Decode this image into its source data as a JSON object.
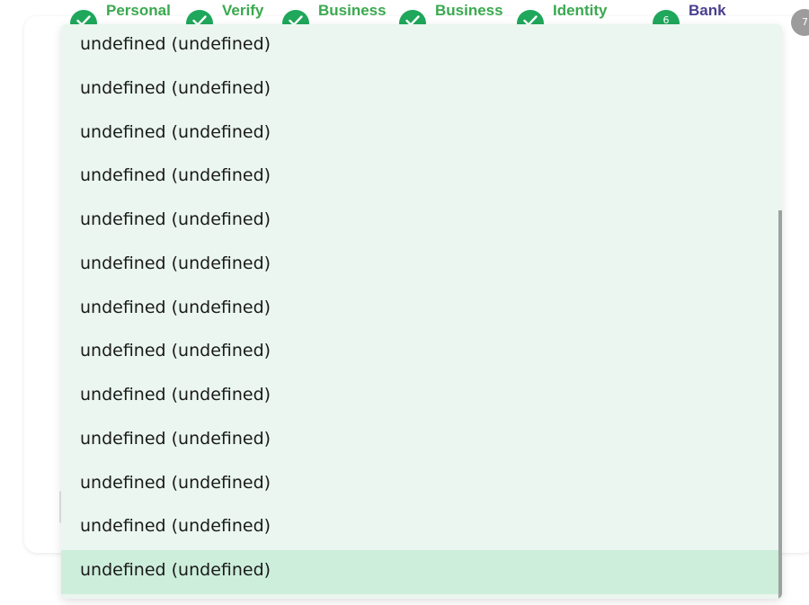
{
  "stepper": {
    "steps": [
      {
        "label": "Personal",
        "status": "done",
        "icon": "check-icon"
      },
      {
        "label": "Verify",
        "status": "done",
        "icon": "check-icon"
      },
      {
        "label": "Business",
        "status": "done",
        "icon": "check-icon"
      },
      {
        "label": "Business",
        "status": "done",
        "icon": "check-icon"
      },
      {
        "label": "Identity",
        "status": "done",
        "icon": "check-icon"
      },
      {
        "label": "Bank",
        "status": "current",
        "number": "6"
      },
      {
        "label": "",
        "status": "pending",
        "number": "7"
      }
    ]
  },
  "dropdown": {
    "options": [
      "undefined (undefined)",
      "undefined (undefined)",
      "undefined (undefined)",
      "undefined (undefined)",
      "undefined (undefined)",
      "undefined (undefined)",
      "undefined (undefined)",
      "undefined (undefined)",
      "undefined (undefined)",
      "undefined (undefined)",
      "undefined (undefined)",
      "undefined (undefined)",
      "undefined (undefined)"
    ],
    "highlighted_index": 12
  },
  "colors": {
    "step_done": "#3aa94f",
    "step_current": "#4a3f8f",
    "dropdown_bg": "#eaf6ef",
    "option_highlight": "#cdeedb"
  }
}
